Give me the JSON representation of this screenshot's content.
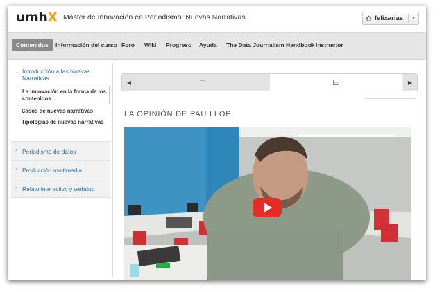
{
  "header": {
    "logo_main": "umh",
    "logo_accent": "X",
    "course_name": "Máster de Innovación en Periodismo:",
    "course_subtitle": "Nuevas Narrativas",
    "user": "felixarias"
  },
  "nav": {
    "items": [
      "Contenidos",
      "Información del curso",
      "Foro",
      "Wiki",
      "Progreso",
      "Ayuda",
      "The Data Journalism Handbook",
      "Instructor"
    ],
    "active": "Contenidos"
  },
  "sidebar": {
    "open_chapter": {
      "title": "Introducción a las Nuevas Narrativas",
      "sections": [
        {
          "label": "La innovación en la forma de los contenidos",
          "active": true
        },
        {
          "label": "Casos de nuevas narrativas",
          "active": false
        },
        {
          "label": "Tipologías de nuevas narrativas",
          "active": false
        }
      ]
    },
    "chapters": [
      "Periodismo de datos",
      "Producción multimedia",
      "Relato interactivo y webdoc"
    ]
  },
  "sequence": {
    "tab_list_icon": "list-icon",
    "tab_video_icon": "video-icon"
  },
  "unit": {
    "title": "LA OPINIÓN DE PAU LLOP"
  },
  "colors": {
    "accent": "#f39a1e",
    "link": "#2a6fb0",
    "active_nav": "#8a8a8a",
    "play_button": "#e52d27"
  }
}
